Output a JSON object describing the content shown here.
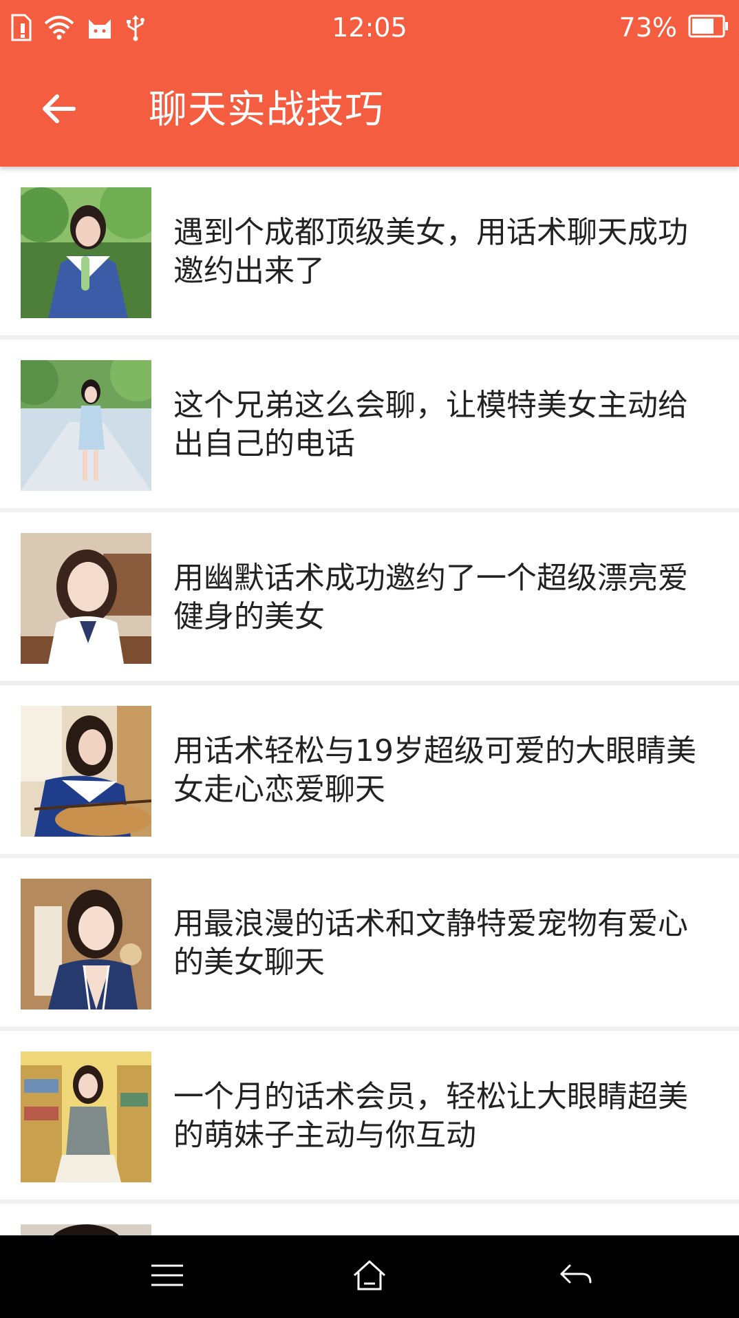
{
  "status_bar": {
    "time": "12:05",
    "battery": "73%",
    "battery_level": 0.73,
    "icons": [
      "sim-card-icon",
      "wifi-icon",
      "cat-notification-icon",
      "usb-icon",
      "battery-icon"
    ]
  },
  "header": {
    "title": "聊天实战技巧",
    "back_icon": "back-arrow-icon"
  },
  "articles": [
    {
      "title": "遇到个成都顶级美女，用话术聊天成功邀约出来了"
    },
    {
      "title": " 这个兄弟这么会聊，让模特美女主动给出自己的电话"
    },
    {
      "title": "用幽默话术成功邀约了一个超级漂亮爱健身的美女"
    },
    {
      "title": "用话术轻松与19岁超级可爱的大眼睛美女走心恋爱聊天"
    },
    {
      "title": "用最浪漫的话术和文静特爱宠物有爱心的美女聊天"
    },
    {
      "title": "一个月的话术会员，轻松让大眼睛超美的萌妹子主动与你互动"
    }
  ],
  "nav": {
    "icons": [
      "menu-icon",
      "home-icon",
      "back-icon"
    ]
  },
  "colors": {
    "accent": "#f45d3f",
    "text": "#222222",
    "divider": "#f0f0f0",
    "nav_bg": "#000000"
  }
}
